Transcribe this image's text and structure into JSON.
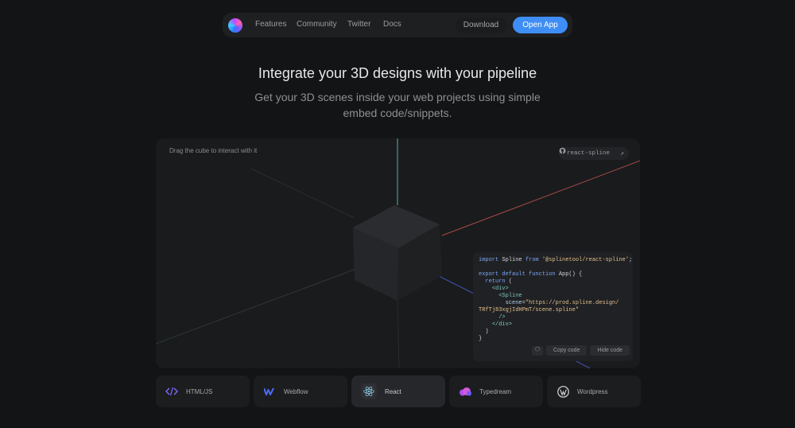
{
  "nav": {
    "links": [
      "Features",
      "Community",
      "Twitter",
      "Docs"
    ],
    "download_label": "Download",
    "open_app_label": "Open App"
  },
  "hero": {
    "title": "Integrate your 3D designs with your pipeline",
    "subtitle_line1": "Get your 3D scenes inside your web projects using simple",
    "subtitle_line2": "embed code/snippets."
  },
  "viewer": {
    "hint": "Drag the cube to interact with it",
    "repo_badge": "react-spline",
    "code_lines": [
      "import Spline from '@splinetool/react-spline';",
      "",
      "export default function App() {",
      "  return (",
      "    <div>",
      "      <Spline",
      "        scene=\"https://prod.spline.design/",
      "TRfTj83xgjIdHPmT/scene.spline\"",
      "      />",
      "    </div>",
      "  )",
      "}"
    ],
    "copy_label": "Copy code",
    "hide_label": "Hide code"
  },
  "integrations": [
    {
      "label": "HTML/JS",
      "icon": "code-icon"
    },
    {
      "label": "Webflow",
      "icon": "webflow-icon"
    },
    {
      "label": "React",
      "icon": "react-icon",
      "active": true
    },
    {
      "label": "Typedream",
      "icon": "typedream-icon"
    },
    {
      "label": "Wordpress",
      "icon": "wordpress-icon"
    }
  ],
  "colors": {
    "accent": "#3f8ef5",
    "background": "#131415",
    "panel": "#1a1b1d"
  }
}
